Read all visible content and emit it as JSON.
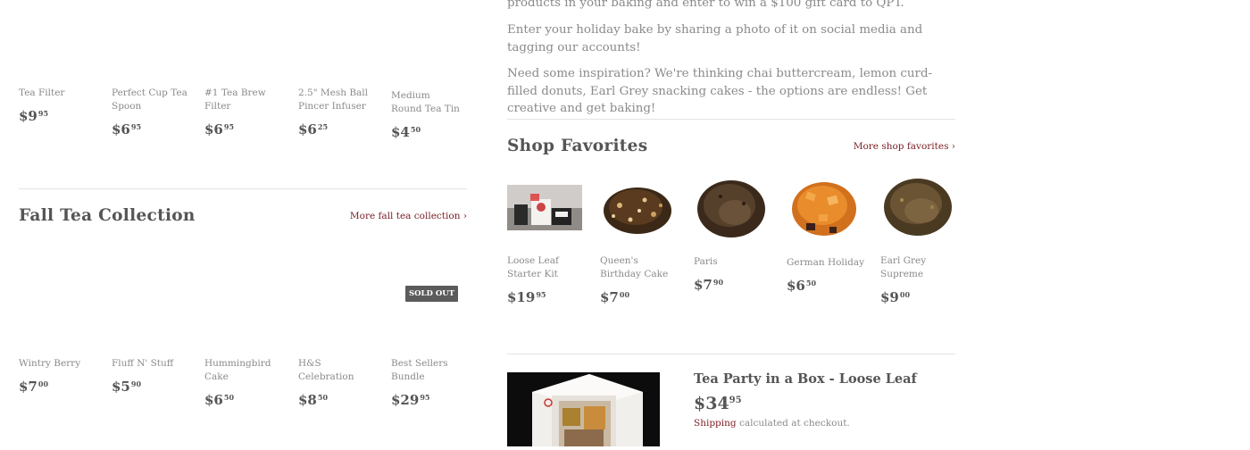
{
  "left": {
    "row1": [
      {
        "name": "Tea Filter",
        "dollars": "$9",
        "cents": "95"
      },
      {
        "name": "Perfect Cup Tea Spoon",
        "dollars": "$6",
        "cents": "95"
      },
      {
        "name": "#1 Tea Brew Filter",
        "dollars": "$6",
        "cents": "95"
      },
      {
        "name": "2.5\" Mesh Ball Pincer Infuser",
        "dollars": "$6",
        "cents": "25"
      },
      {
        "name": "Medium Round Tea Tin",
        "dollars": "$4",
        "cents": "50"
      }
    ],
    "fall_title": "Fall Tea Collection",
    "fall_more": "More fall tea collection ›",
    "sold_out": "SOLD OUT",
    "row2": [
      {
        "name": "Wintry Berry",
        "dollars": "$7",
        "cents": "00"
      },
      {
        "name": "Fluff N' Stuff",
        "dollars": "$5",
        "cents": "90"
      },
      {
        "name": "Hummingbird Cake",
        "dollars": "$6",
        "cents": "50"
      },
      {
        "name": "H&S Celebration",
        "dollars": "$8",
        "cents": "50"
      },
      {
        "name": "Best Sellers Bundle",
        "dollars": "$29",
        "cents": "95"
      }
    ]
  },
  "right": {
    "paragraph1": "products in your baking and enter to win a $100 gift card to QPT.",
    "paragraph2": "Enter your holiday bake by sharing a photo of it on social media and tagging our accounts!",
    "paragraph3": "Need some inspiration? We're thinking chai buttercream, lemon curd-filled donuts, Earl Grey snacking cakes - the options are endless! Get creative and get baking!",
    "favorites_title": "Shop Favorites",
    "favorites_more": "More shop favorites ›",
    "favorites": [
      {
        "name": "Loose Leaf Starter Kit",
        "dollars": "$19",
        "cents": "95"
      },
      {
        "name": "Queen's Birthday Cake",
        "dollars": "$7",
        "cents": "00"
      },
      {
        "name": "Paris",
        "dollars": "$7",
        "cents": "90"
      },
      {
        "name": "German Holiday",
        "dollars": "$6",
        "cents": "50"
      },
      {
        "name": "Earl Grey Supreme",
        "dollars": "$9",
        "cents": "00"
      }
    ],
    "featured": {
      "title": "Tea Party in a Box - Loose Leaf",
      "dollars": "$34",
      "cents": "95",
      "shipping_link": "Shipping",
      "shipping_rest": " calculated at checkout."
    }
  },
  "colors": {
    "link": "#7a1e24",
    "text": "#555555",
    "muted": "#8a8a8a",
    "rule": "#e3e3e3",
    "badge": "#5b5b5b"
  }
}
